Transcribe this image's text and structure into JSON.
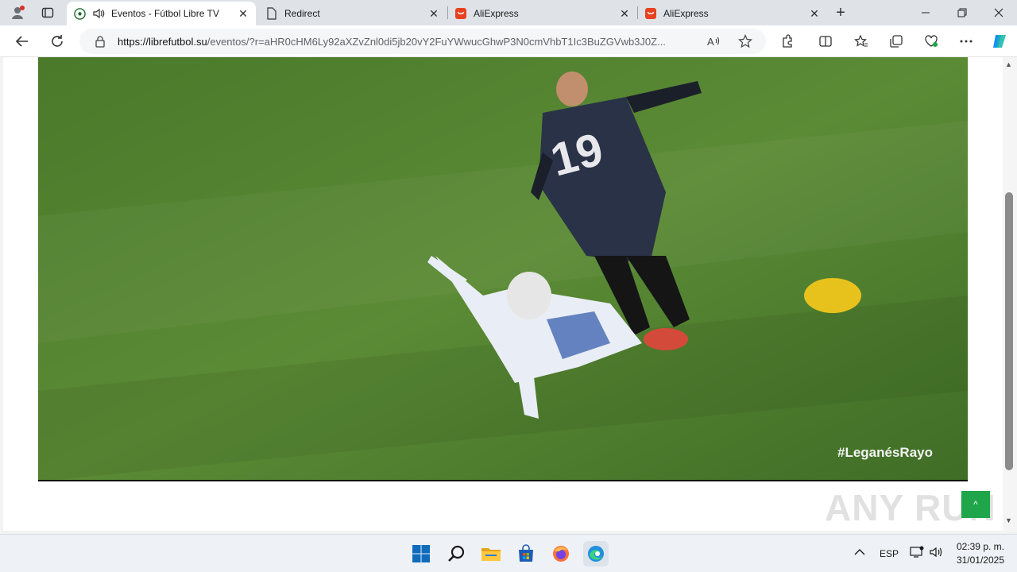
{
  "browser": {
    "tabs": [
      {
        "title": "Eventos - Fútbol Libre TV",
        "active": true,
        "favicon": "soccer-ball-icon",
        "audio": true
      },
      {
        "title": "Redirect",
        "active": false,
        "favicon": "page-icon"
      },
      {
        "title": "AliExpress",
        "active": false,
        "favicon": "aliexpress-icon"
      },
      {
        "title": "AliExpress",
        "active": false,
        "favicon": "aliexpress-icon"
      }
    ],
    "address": {
      "domain": "https://librefutbol.su",
      "path": "/eventos/?r=aHR0cHM6Ly92aXZvZnl0di5jb20vY2FuYWwucGhwP3N0cmVhbT1Ic3BuZGVwb3J0Z..."
    },
    "accent": "#1a73e8"
  },
  "video": {
    "overlay_text": "#LeganésRayo",
    "jersey_number": "19"
  },
  "page": {
    "back_to_top_label": "^",
    "watermark": "ANY RUN"
  },
  "taskbar": {
    "language": "ESP",
    "time": "02:39 p. m.",
    "date": "31/01/2025"
  }
}
